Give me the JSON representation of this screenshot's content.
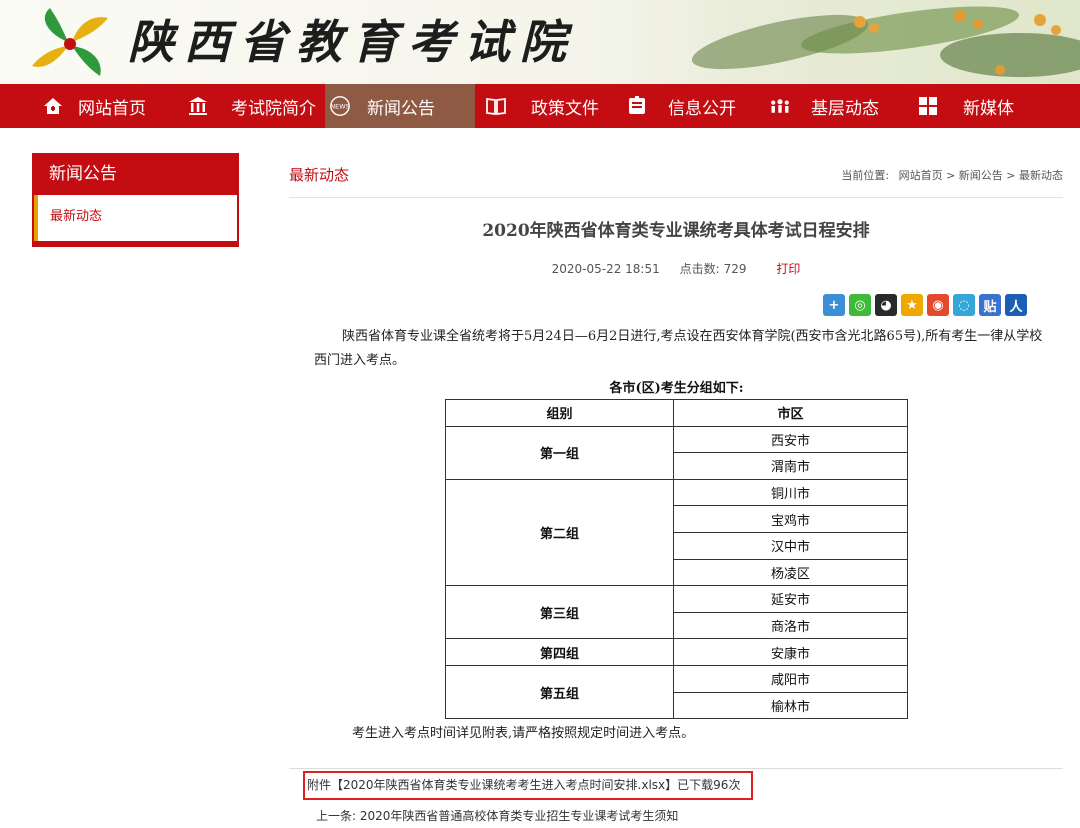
{
  "header": {
    "site_title": "陕西省教育考试院"
  },
  "nav": {
    "items": [
      {
        "label": "网站首页",
        "icon": "home-icon"
      },
      {
        "label": "考试院简介",
        "icon": "building-icon"
      },
      {
        "label": "新闻公告",
        "icon": "news-globe-icon",
        "badge": "NEWS",
        "active": true
      },
      {
        "label": "政策文件",
        "icon": "book-icon"
      },
      {
        "label": "信息公开",
        "icon": "announce-icon"
      },
      {
        "label": "基层动态",
        "icon": "people-icon"
      },
      {
        "label": "新媒体",
        "icon": "grid-icon"
      }
    ]
  },
  "sidebar": {
    "title": "新闻公告",
    "items": [
      {
        "label": "最新动态",
        "active": true
      }
    ]
  },
  "breadcrumb": {
    "section": "最新动态",
    "location_prefix": "当前位置:",
    "path": "网站首页 > 新闻公告 > 最新动态"
  },
  "article": {
    "title": "2020年陕西省体育类专业课统考具体考试日程安排",
    "date": "2020-05-22 18:51",
    "views_label": "点击数:",
    "views": "729",
    "print_label": "打印",
    "paragraph": "陕西省体育专业课全省统考将于5月24日—6月2日进行,考点设在西安体育学院(西安市含光北路65号),所有考生一律从学校西门进入考点。",
    "table_caption": "各市(区)考生分组如下:",
    "table": {
      "headers": [
        "组别",
        "市区"
      ],
      "groups": [
        {
          "name": "第一组",
          "cities": [
            "西安市",
            "渭南市"
          ]
        },
        {
          "name": "第二组",
          "cities": [
            "铜川市",
            "宝鸡市",
            "汉中市",
            "杨凌区"
          ]
        },
        {
          "name": "第三组",
          "cities": [
            "延安市",
            "商洛市"
          ]
        },
        {
          "name": "第四组",
          "cities": [
            "安康市"
          ]
        },
        {
          "name": "第五组",
          "cities": [
            "咸阳市",
            "榆林市"
          ]
        }
      ]
    },
    "note": "考生进入考点时间详见附表,请严格按照规定时间进入考点。"
  },
  "share": {
    "icons": [
      {
        "name": "share-more-icon",
        "glyph": "+",
        "color": "#3c8fd6"
      },
      {
        "name": "wechat-icon",
        "glyph": "◎",
        "color": "#3fb93a"
      },
      {
        "name": "qq-icon",
        "glyph": "◕",
        "color": "#2a2a2a"
      },
      {
        "name": "qzone-icon",
        "glyph": "★",
        "color": "#f0a800"
      },
      {
        "name": "weibo-icon",
        "glyph": "◉",
        "color": "#e2492f"
      },
      {
        "name": "tencent-weibo-icon",
        "glyph": "◌",
        "color": "#34a7d8"
      },
      {
        "name": "tieba-icon",
        "glyph": "贴",
        "color": "#3b72d0"
      },
      {
        "name": "renren-icon",
        "glyph": "人",
        "color": "#1b5fb4"
      }
    ]
  },
  "attachment": {
    "prefix": "附件",
    "file": "【2020年陕西省体育类专业课统考考生进入考点时间安排.xlsx】",
    "downloads": "已下载96次"
  },
  "prev_article": {
    "label": "上一条:",
    "title": "2020年陕西省普通高校体育类专业招生专业课考试考生须知"
  },
  "colors": {
    "brand_red": "#c40d12",
    "active_nav": "#8f5a44",
    "accent_gold": "#e6a000"
  }
}
